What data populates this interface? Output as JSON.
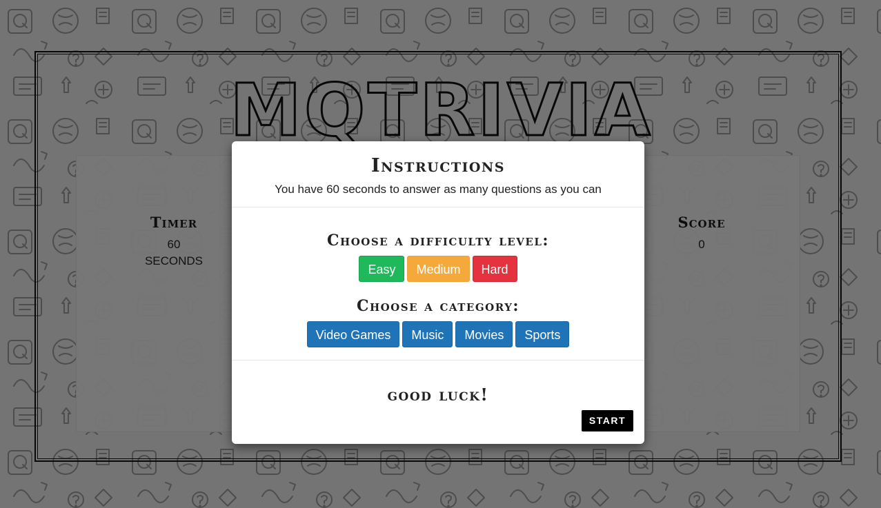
{
  "app": {
    "title": "MQTRIVIA"
  },
  "stats": {
    "timer_label": "Timer",
    "timer_value": "60",
    "timer_unit": "SECONDS",
    "score_label": "Score",
    "score_value": "0"
  },
  "modal": {
    "title": "Instructions",
    "subtitle": "You have 60 seconds to answer as many questions as you can",
    "difficulty_title": "Choose a difficulty level:",
    "difficulties": [
      {
        "label": "Easy",
        "color": "#1fb95b"
      },
      {
        "label": "Medium",
        "color": "#f5a93b"
      },
      {
        "label": "Hard",
        "color": "#e5323f"
      }
    ],
    "category_title": "Choose a category:",
    "categories": [
      {
        "label": "Video Games"
      },
      {
        "label": "Music"
      },
      {
        "label": "Movies"
      },
      {
        "label": "Sports"
      }
    ],
    "good_luck": "good luck!",
    "start_label": "START"
  },
  "colors": {
    "category_button": "#1f74b7",
    "start_button": "#000000",
    "overlay": "rgba(0,0,0,0.5)"
  }
}
